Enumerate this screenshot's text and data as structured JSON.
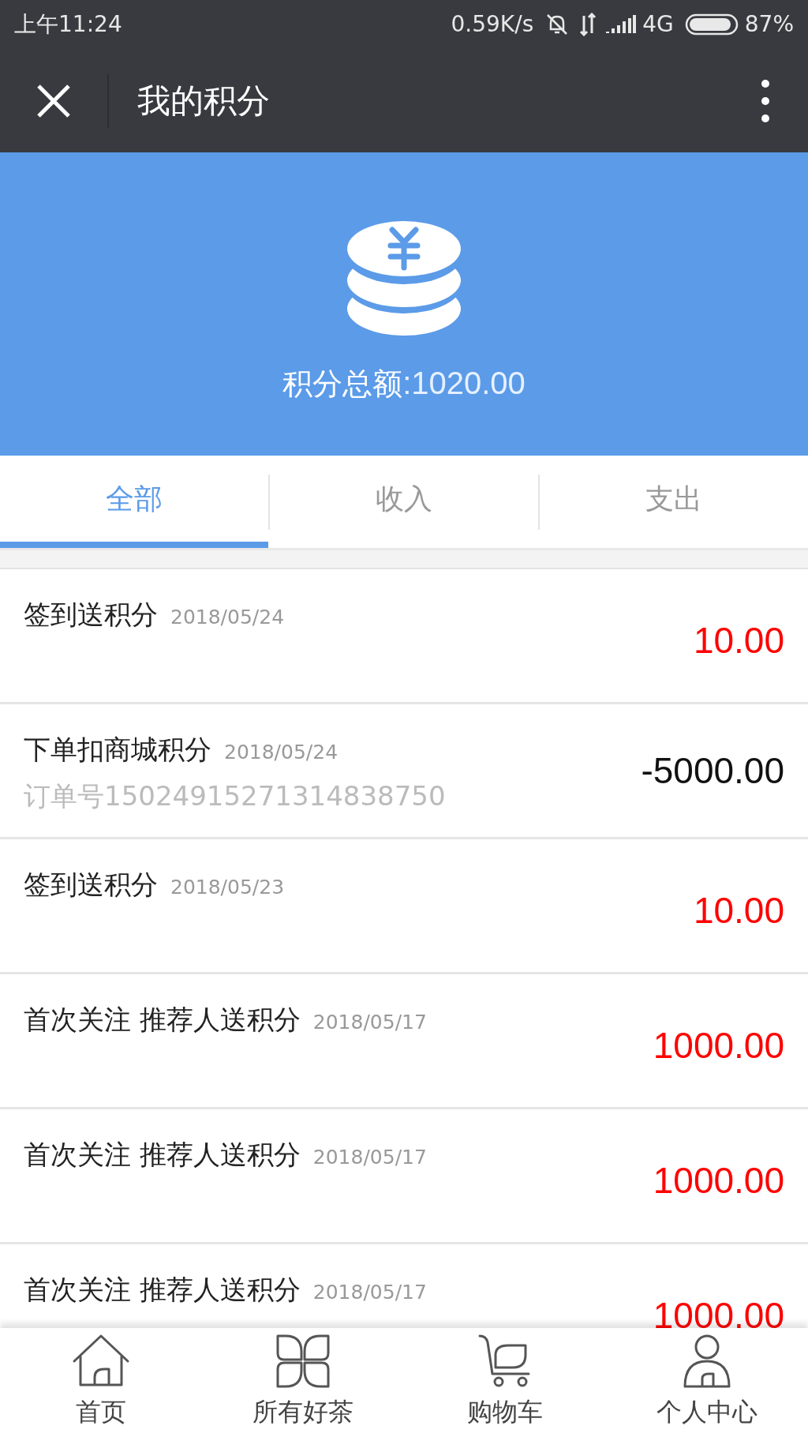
{
  "status_bar": {
    "time": "上午11:24",
    "speed": "0.59K/s",
    "network": "4G",
    "battery": "87%"
  },
  "title": "我的积分",
  "total": {
    "label": "积分总额",
    "value": ":1020.00"
  },
  "tabs": [
    {
      "label": "全部",
      "selected": true
    },
    {
      "label": "收入",
      "selected": false
    },
    {
      "label": "支出",
      "selected": false
    }
  ],
  "records": [
    {
      "title": "签到送积分",
      "date": "2018/05/24",
      "amount": "10.00",
      "kind": "income"
    },
    {
      "title": "下单扣商城积分",
      "date": "2018/05/24",
      "order": "订单号15024915271314838750",
      "amount": "-5000.00",
      "kind": "expense"
    },
    {
      "title": "签到送积分",
      "date": "2018/05/23",
      "amount": "10.00",
      "kind": "income"
    },
    {
      "title": "首次关注 推荐人送积分",
      "date": "2018/05/17",
      "amount": "1000.00",
      "kind": "income"
    },
    {
      "title": "首次关注 推荐人送积分",
      "date": "2018/05/17",
      "amount": "1000.00",
      "kind": "income"
    },
    {
      "title": "首次关注 推荐人送积分",
      "date": "2018/05/17",
      "amount": "1000.00",
      "kind": "income"
    }
  ],
  "bottom_nav": [
    {
      "label": "首页",
      "kind": "home"
    },
    {
      "label": "所有好茶",
      "kind": "products"
    },
    {
      "label": "购物车",
      "kind": "cart"
    },
    {
      "label": "个人中心",
      "kind": "profile"
    }
  ]
}
